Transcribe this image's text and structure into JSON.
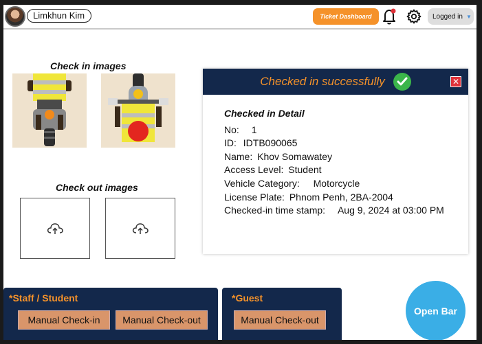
{
  "header": {
    "user_name": "Limkhun Kim",
    "ticket_button": "Ticket Dashboard",
    "login_status": "Logged in"
  },
  "checkin_section": {
    "title": "Check in images"
  },
  "checkout_section": {
    "title": "Check out images"
  },
  "card": {
    "status_title": "Checked in successfully",
    "close_symbol": "✕",
    "detail_heading": "Checked in Detail",
    "fields": {
      "no_label": "No:",
      "no_value": "1",
      "id_label": "ID:",
      "id_value": "IDTB090065",
      "name_label": "Name:",
      "name_value": "Khov Somawatey",
      "access_label": "Access Level:",
      "access_value": "Student",
      "vehicle_label": "Vehicle Category:",
      "vehicle_value": "Motorcycle",
      "plate_label": "License Plate:",
      "plate_value": "Phnom Penh, 2BA-2004",
      "time_label": "Checked-in time stamp:",
      "time_value": "Aug 9, 2024 at 03:00 PM"
    }
  },
  "staff_panel": {
    "title": "*Staff / Student",
    "checkin_button": "Manual Check-in",
    "checkout_button": "Manual Check-out"
  },
  "guest_panel": {
    "title": "*Guest",
    "checkout_button": "Manual Check-out"
  },
  "open_bar_button": "Open Bar",
  "colors": {
    "navy": "#13284b",
    "accent_orange": "#f5922a",
    "success_green": "#3bb54a",
    "open_bar_blue": "#3aaee6"
  },
  "icons": [
    "avatar",
    "bell-icon",
    "gear-icon",
    "chevron-down-icon",
    "checkmark-icon",
    "close-icon",
    "upload-cloud-icon"
  ]
}
